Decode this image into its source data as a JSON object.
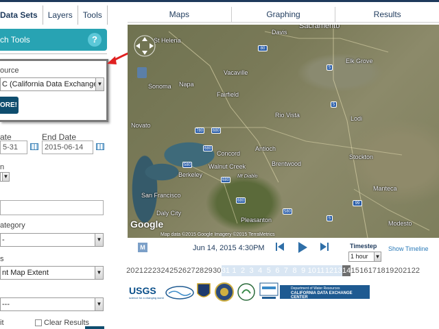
{
  "left_tabs": [
    "Data Sets",
    "Layers",
    "Tools"
  ],
  "right_tabs": [
    "Maps",
    "Graphing",
    "Results"
  ],
  "tools_bar": {
    "label": "ch Tools",
    "help": "?"
  },
  "source": {
    "label": "ource",
    "selected": "C (California Data Exchange)",
    "explore_label": "ORE!"
  },
  "dates": {
    "start_label": "ate",
    "start_value": "5-31",
    "end_label": "End Date",
    "end_value": "2015-06-14"
  },
  "fields": {
    "interval_label": "n",
    "category_label": "ategory",
    "category_value": "-",
    "extent_label": "s",
    "extent_value": "nt Map Extent",
    "extra_value": "---",
    "limit_label": "it",
    "clear_label": "Clear Results"
  },
  "map": {
    "labels": [
      "St Helena",
      "Davis",
      "Sacramento",
      "Vacaville",
      "Napa",
      "Sonoma",
      "Fairfield",
      "Elk Grove",
      "Novato",
      "Rio Vista",
      "Lodi",
      "Concord",
      "Antioch",
      "Brentwood",
      "Walnut Creek",
      "Mt Diablo",
      "Stockton",
      "Berkeley",
      "San Francisco",
      "Daly City",
      "Pleasanton",
      "Manteca",
      "Modesto"
    ],
    "shields": [
      "80",
      "5",
      "5",
      "680",
      "780",
      "680",
      "580",
      "680",
      "680",
      "580",
      "99",
      "5"
    ],
    "attribution": "Map data ©2015 Google Imagery ©2015 TerraMetrics",
    "logo": "Google"
  },
  "timeline": {
    "m_button": "M",
    "datetime": "Jun 14, 2015 4:30PM",
    "timestep_label": "Timestep",
    "timestep_value": "1 hour",
    "show_timeline": "Show Timeline",
    "days": [
      "20",
      "21",
      "22",
      "23",
      "24",
      "25",
      "26",
      "27",
      "28",
      "29",
      "30",
      "31",
      "1",
      "2",
      "3",
      "4",
      "5",
      "6",
      "7",
      "8",
      "9",
      "10",
      "11",
      "12",
      "13",
      "14",
      "15",
      "16",
      "17",
      "18",
      "19",
      "20",
      "21",
      "22"
    ],
    "selected_range": [
      11,
      24
    ],
    "current_index": 25
  },
  "logos": {
    "usgs": "USGS",
    "usgs_sub": "science for a changing world",
    "dwr_top": "Department of Water Resources",
    "dwr_bottom": "CALIFORNIA DATA EXCHANGE CENTER",
    "other": [
      "california-state-seal",
      "water-board-seal",
      "usbr-seal",
      "fish-wildlife-seal",
      "swamp-logo"
    ]
  },
  "colors": {
    "nav": "#1e3a5c",
    "accent": "#28a3b3",
    "button_dark": "#0e4d6e",
    "annotation_arrow": "#e02020"
  }
}
